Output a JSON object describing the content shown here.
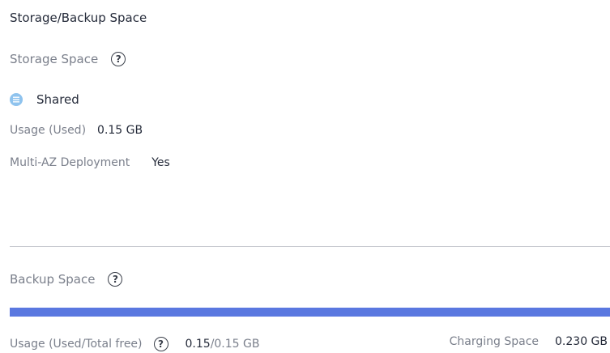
{
  "storage": {
    "section_title": "Storage/Backup Space",
    "storage_space_label": "Storage Space",
    "help_glyph": "?",
    "type_icon": "storage-list-icon",
    "type_label": "Shared",
    "usage_label": "Usage (Used)",
    "usage_value": "0.15 GB",
    "multi_az_label": "Multi-AZ Deployment",
    "multi_az_value": "Yes"
  },
  "backup": {
    "backup_space_label": "Backup Space",
    "usage_bar_fraction": 1.0,
    "usage_label": "Usage (Used/Total free)",
    "used_value": "0.15",
    "total_value": "/0.15 GB",
    "charging_label": "Charging Space",
    "charging_value": "0.230 GB"
  },
  "colors": {
    "bar_fill": "#5a78e0",
    "icon_fill": "#8fc3ee"
  }
}
